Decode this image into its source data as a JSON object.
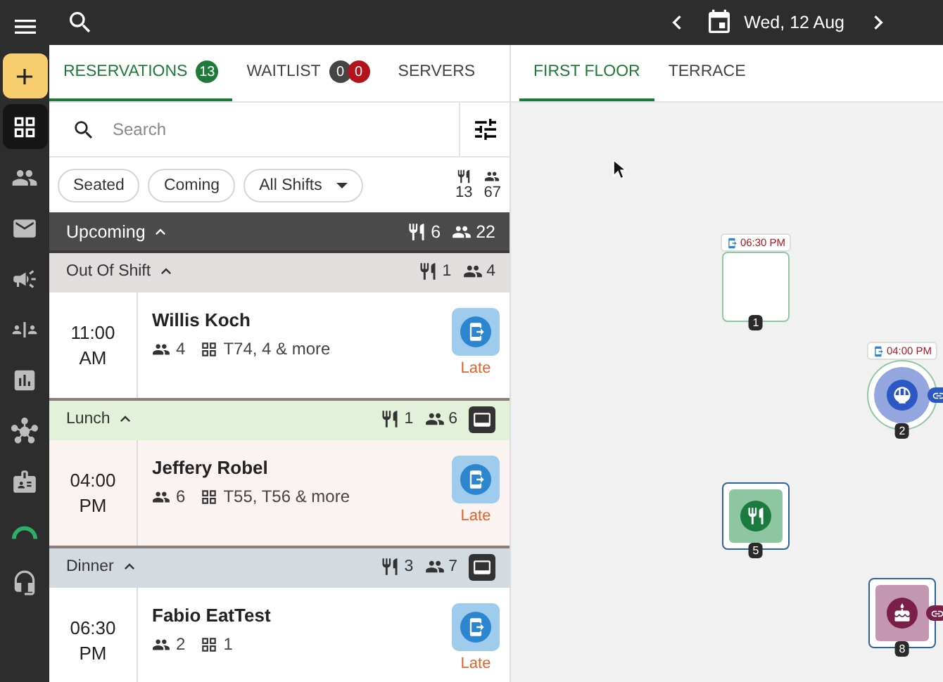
{
  "sidebar": {
    "items": [
      {
        "kind": "grid",
        "selected": true
      },
      {
        "kind": "people",
        "selected": false
      },
      {
        "kind": "mail",
        "selected": false
      },
      {
        "kind": "megaphone",
        "selected": false
      },
      {
        "kind": "split",
        "selected": false
      },
      {
        "kind": "chart",
        "selected": false
      },
      {
        "kind": "hub",
        "selected": false
      },
      {
        "kind": "badge",
        "selected": false
      },
      {
        "kind": "gauge",
        "selected": false
      },
      {
        "kind": "headset",
        "selected": false
      }
    ]
  },
  "topbar": {
    "date": "Wed, 12 Aug"
  },
  "list_tabs": [
    {
      "label": "RESERVATIONS",
      "selected": true,
      "badges": [
        {
          "text": "13",
          "color": "#1f7a3a"
        }
      ]
    },
    {
      "label": "WAITLIST",
      "selected": false,
      "badges": [
        {
          "text": "0",
          "color": "#444444"
        },
        {
          "text": "0",
          "color": "#b3141b"
        }
      ]
    },
    {
      "label": "SERVERS",
      "selected": false
    }
  ],
  "search": {
    "placeholder": "Search"
  },
  "filters": [
    {
      "label": "Seated",
      "kind": "chip"
    },
    {
      "label": "Coming",
      "kind": "chip"
    },
    {
      "label": "All Shifts",
      "kind": "dropdown"
    }
  ],
  "totals": {
    "covers": "13",
    "guests": "67"
  },
  "sections": [
    {
      "kind": "status",
      "label": "Upcoming",
      "expanded": true,
      "covers": "6",
      "guests": "22",
      "color": "#4a4a4a",
      "has_button": false
    },
    {
      "kind": "shift",
      "label": "Out Of Shift",
      "expanded": true,
      "covers": "1",
      "guests": "4",
      "color": "#e2dede",
      "has_button": false,
      "reservations": [
        {
          "time": "11:00",
          "period": "AM",
          "name": "Willis Koch",
          "party": "4",
          "tables": "T74, 4 & more",
          "status": "Late",
          "color": "#ffffff"
        }
      ]
    },
    {
      "kind": "shift",
      "label": "Lunch",
      "expanded": true,
      "covers": "1",
      "guests": "6",
      "color": "#e4f1da",
      "has_button": true,
      "reservations": [
        {
          "time": "04:00",
          "period": "PM",
          "name": "Jeffery Robel",
          "party": "6",
          "tables": "T55, T56 & more",
          "status": "Late",
          "color": "#fbf3f1"
        }
      ]
    },
    {
      "kind": "shift",
      "label": "Dinner",
      "expanded": true,
      "covers": "3",
      "guests": "7",
      "color": "#d3dbe1",
      "has_button": true,
      "reservations": [
        {
          "time": "06:30",
          "period": "PM",
          "name": "Fabio EatTest",
          "party": "2",
          "tables": "1",
          "status": "Late",
          "color": "#ffffff"
        }
      ]
    }
  ],
  "floor_tabs": [
    {
      "label": "FIRST FLOOR",
      "selected": true
    },
    {
      "label": "TERRACE",
      "selected": false
    }
  ],
  "tables": [
    {
      "number": "1",
      "kind": "reserved",
      "time": "06:30 PM",
      "linked": false,
      "color": "#ffffff"
    },
    {
      "number": "2",
      "kind": "round",
      "time": "04:00 PM",
      "linked": true,
      "color": "#94a6e0"
    },
    {
      "number": "5",
      "kind": "main",
      "linked": false,
      "color": "#8ec6a2"
    },
    {
      "number": "8",
      "kind": "dessert",
      "linked": true,
      "color": "#c397b0"
    }
  ]
}
